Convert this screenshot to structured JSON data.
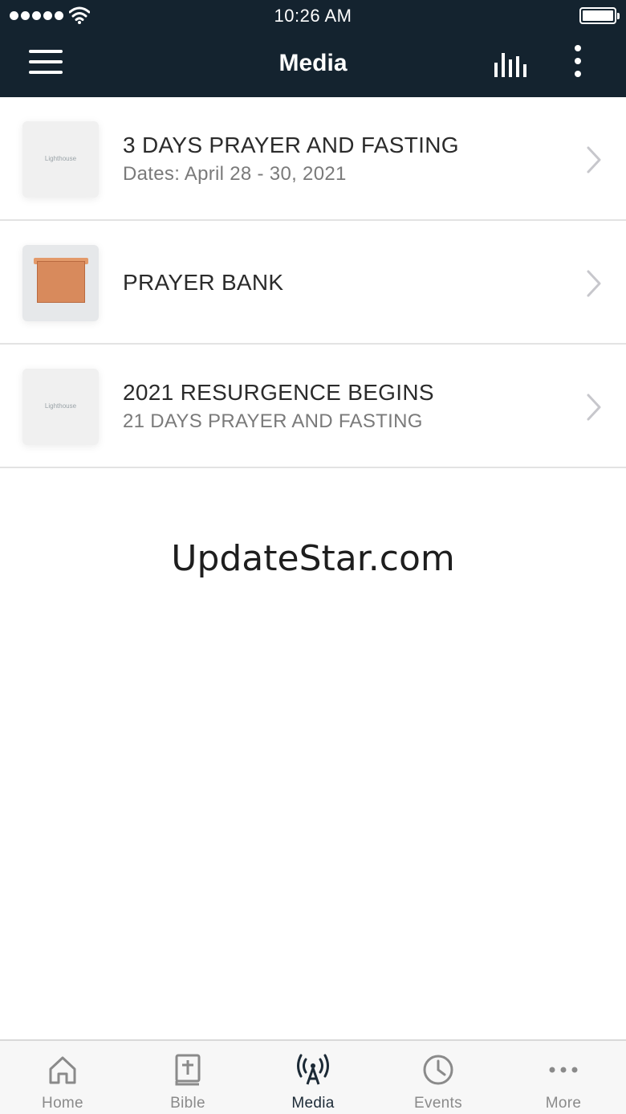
{
  "status_bar": {
    "time": "10:26 AM"
  },
  "nav": {
    "title": "Media",
    "icons": [
      "hamburger-menu-icon",
      "audio-bars-icon",
      "more-vertical-icon"
    ]
  },
  "media_items": [
    {
      "title": "3 DAYS PRAYER AND FASTING",
      "subtitle": "Dates: April 28 - 30, 2021",
      "thumbnail": "lighthouse-logo",
      "logo_text": "Lighthouse"
    },
    {
      "title": "PRAYER BANK",
      "subtitle": "",
      "thumbnail": "wooden-box-photo"
    },
    {
      "title": "2021 RESURGENCE BEGINS",
      "subtitle": "21 DAYS PRAYER AND FASTING",
      "thumbnail": "lighthouse-logo",
      "logo_text": "Lighthouse"
    }
  ],
  "watermark": "UpdateStar.com",
  "tabs": [
    {
      "label": "Home",
      "icon": "home-icon",
      "active": false
    },
    {
      "label": "Bible",
      "icon": "bible-icon",
      "active": false
    },
    {
      "label": "Media",
      "icon": "broadcast-icon",
      "active": true
    },
    {
      "label": "Events",
      "icon": "clock-icon",
      "active": false
    },
    {
      "label": "More",
      "icon": "more-horizontal-icon",
      "active": false
    }
  ],
  "colors": {
    "header_bg": "#14232f",
    "active_tab": "#1c2a36",
    "inactive_tab": "#8a8a8a"
  }
}
